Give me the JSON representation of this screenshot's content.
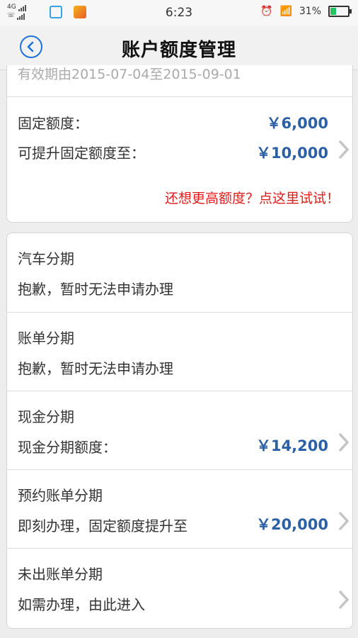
{
  "status_bar": {
    "network": "4G",
    "time": "6:23",
    "battery": "31%",
    "battery_level": 0.31
  },
  "header": {
    "title": "账户额度管理"
  },
  "credit_card": {
    "validity": "有效期由2015-07-04至2015-09-01",
    "fixed_limit_label": "固定额度：",
    "fixed_limit_value": "￥6,000",
    "raisable_label": "可提升固定额度至：",
    "raisable_value": "￥10,000",
    "promo_link": "还想更高额度？点这里试试！"
  },
  "installments": [
    {
      "title": "汽车分期",
      "subtitle": "抱歉，暂时无法申请办理",
      "amount": ""
    },
    {
      "title": "账单分期",
      "subtitle": "抱歉，暂时无法申请办理",
      "amount": ""
    },
    {
      "title": "现金分期",
      "subtitle": "现金分期额度：",
      "amount": "￥14,200"
    },
    {
      "title": "预约账单分期",
      "subtitle": "即刻办理，固定额度提升至",
      "amount": "￥20,000"
    },
    {
      "title": "未出账单分期",
      "subtitle": "如需办理，由此进入",
      "amount": ""
    }
  ]
}
